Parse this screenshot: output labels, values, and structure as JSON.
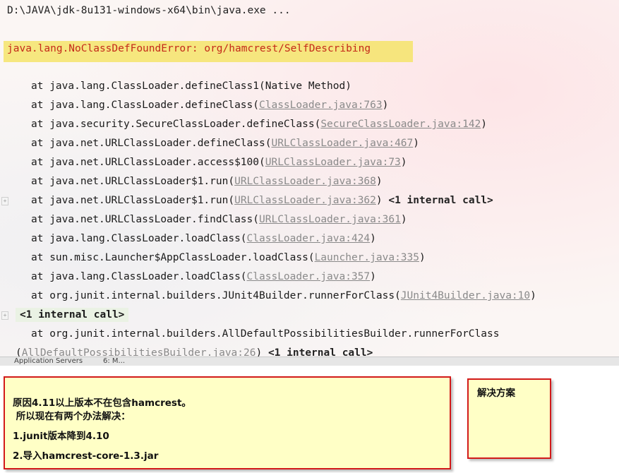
{
  "console": {
    "exe_path": "D:\\JAVA\\jdk-8u131-windows-x64\\bin\\java.exe ...",
    "error": "java.lang.NoClassDefFoundError: org/hamcrest/SelfDescribing",
    "frames": [
      {
        "prefix": "at java.lang.ClassLoader.defineClass1(Native Method)",
        "link": "",
        "suffix": "",
        "internal": ""
      },
      {
        "prefix": "at java.lang.ClassLoader.defineClass(",
        "link": "ClassLoader.java:763",
        "suffix": ")",
        "internal": ""
      },
      {
        "prefix": "at java.security.SecureClassLoader.defineClass(",
        "link": "SecureClassLoader.java:142",
        "suffix": ")",
        "internal": ""
      },
      {
        "prefix": "at java.net.URLClassLoader.defineClass(",
        "link": "URLClassLoader.java:467",
        "suffix": ")",
        "internal": ""
      },
      {
        "prefix": "at java.net.URLClassLoader.access$100(",
        "link": "URLClassLoader.java:73",
        "suffix": ")",
        "internal": ""
      },
      {
        "prefix": "at java.net.URLClassLoader$1.run(",
        "link": "URLClassLoader.java:368",
        "suffix": ")",
        "internal": ""
      },
      {
        "prefix": "at java.net.URLClassLoader$1.run(",
        "link": "URLClassLoader.java:362",
        "suffix": ") ",
        "internal": "<1 internal call>"
      },
      {
        "prefix": "at java.net.URLClassLoader.findClass(",
        "link": "URLClassLoader.java:361",
        "suffix": ")",
        "internal": ""
      },
      {
        "prefix": "at java.lang.ClassLoader.loadClass(",
        "link": "ClassLoader.java:424",
        "suffix": ")",
        "internal": ""
      },
      {
        "prefix": "at sun.misc.Launcher$AppClassLoader.loadClass(",
        "link": "Launcher.java:335",
        "suffix": ")",
        "internal": ""
      },
      {
        "prefix": "at java.lang.ClassLoader.loadClass(",
        "link": "ClassLoader.java:357",
        "suffix": ")",
        "internal": ""
      },
      {
        "prefix": "at org.junit.internal.builders.JUnit4Builder.runnerForClass(",
        "link": "JUnit4Builder.java:10",
        "suffix": ")",
        "internal": ""
      }
    ],
    "internal_call_row": "<1 internal call>",
    "frame_last": "at org.junit.internal.builders.AllDefaultPossibilitiesBuilder.runnerForClass",
    "cut_row": {
      "prefix": "(",
      "link": "AllDefaultPossibilitiesBuilder.java:26",
      "suffix": ") ",
      "internal": "<1 internal call>"
    }
  },
  "bottom_strip": {
    "left_label": "Application Servers",
    "right_label": "6: M..."
  },
  "note_main": {
    "line1": "原因4.11以上版本不在包含hamcrest。",
    "line2": " 所以现在有两个办法解决：",
    "line3": "1.junit版本降到4.10",
    "line4": "2.导入hamcrest-core-1.3.jar"
  },
  "note_side": {
    "title": "解决方案"
  }
}
